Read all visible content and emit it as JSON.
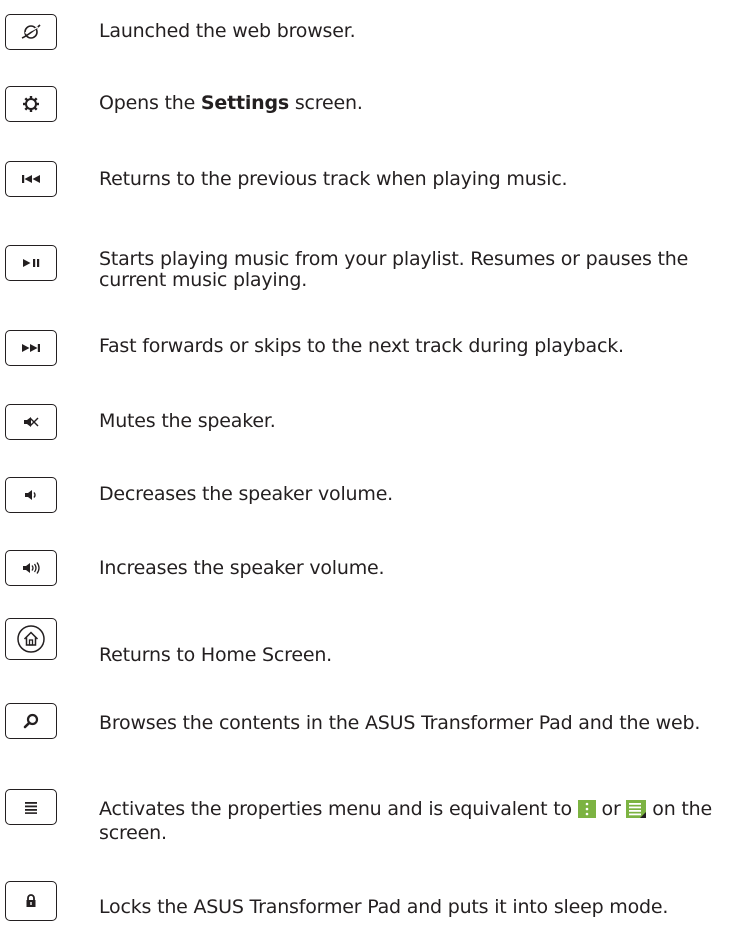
{
  "keys": [
    {
      "icon": "browser-icon",
      "text": "Launched the web browser."
    },
    {
      "icon": "settings-gear-icon",
      "text_before": "Opens the ",
      "text_bold": "Settings",
      "text_after": " screen."
    },
    {
      "icon": "previous-track-icon",
      "text": "Returns to the previous track when playing music."
    },
    {
      "icon": "play-pause-icon",
      "text": "Starts playing music from your playlist. Resumes or pauses the current music playing."
    },
    {
      "icon": "next-track-icon",
      "text": "Fast forwards or skips to the next track during playback."
    },
    {
      "icon": "mute-icon",
      "text": "Mutes the speaker."
    },
    {
      "icon": "volume-down-icon",
      "text": "Decreases the speaker volume."
    },
    {
      "icon": "volume-up-icon",
      "text": "Increases the speaker volume."
    },
    {
      "icon": "home-icon",
      "text": "Returns to Home Screen."
    },
    {
      "icon": "search-icon",
      "text": "Browses the contents in the ASUS Transformer Pad and the web."
    },
    {
      "icon": "menu-icon",
      "text_before": "Activates the properties menu and is equivalent to ",
      "text_mid": " or ",
      "text_after": " on the screen."
    },
    {
      "icon": "lock-icon",
      "text": "Locks the ASUS Transformer Pad and puts it into sleep mode."
    }
  ],
  "colors": {
    "ink": "#231f20",
    "menu_icon_green": "#7cb342"
  }
}
